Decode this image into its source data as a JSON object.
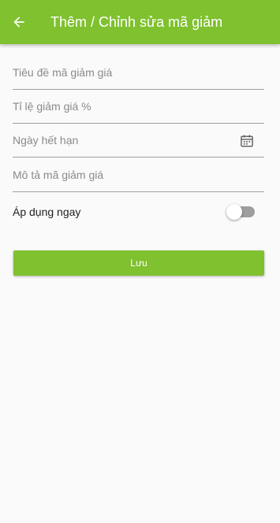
{
  "appbar": {
    "title": "Thêm / Chỉnh sửa mã giảm",
    "back_icon": "arrow-back-icon",
    "color": "#7fc12e"
  },
  "form": {
    "title_field": {
      "placeholder": "Tiêu đề mã giảm giá",
      "value": ""
    },
    "rate_field": {
      "placeholder": "Tỉ lệ giảm giá %",
      "value": ""
    },
    "expiry_field": {
      "placeholder": "Ngày hết hạn",
      "value": "",
      "icon": "calendar-icon"
    },
    "description_field": {
      "placeholder": "Mô tả mã giảm giá",
      "value": ""
    },
    "apply_now": {
      "label": "Áp dụng ngay",
      "checked": false
    }
  },
  "actions": {
    "save_label": "Lưu"
  }
}
